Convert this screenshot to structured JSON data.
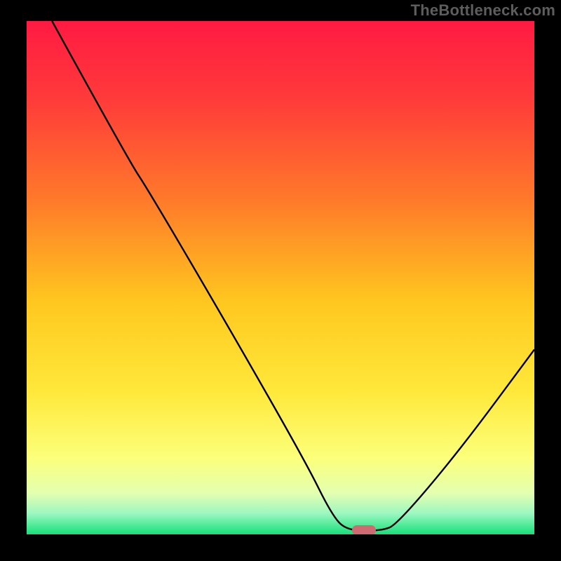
{
  "watermark": "TheBottleneck.com",
  "chart_data": {
    "type": "line",
    "title": "",
    "xlabel": "",
    "ylabel": "",
    "xlim": [
      0,
      100
    ],
    "ylim": [
      0,
      100
    ],
    "gradient_stops": [
      {
        "pos": 0,
        "color": "#ff1a43"
      },
      {
        "pos": 15,
        "color": "#ff3a3a"
      },
      {
        "pos": 35,
        "color": "#ff7a2a"
      },
      {
        "pos": 55,
        "color": "#ffc81f"
      },
      {
        "pos": 72,
        "color": "#ffe83a"
      },
      {
        "pos": 85,
        "color": "#fcff7a"
      },
      {
        "pos": 92,
        "color": "#e4ffb0"
      },
      {
        "pos": 96,
        "color": "#9af7c0"
      },
      {
        "pos": 100,
        "color": "#16e07a"
      }
    ],
    "series": [
      {
        "name": "curve",
        "points": [
          {
            "x": 5,
            "y": 100
          },
          {
            "x": 20,
            "y": 73
          },
          {
            "x": 24,
            "y": 67
          },
          {
            "x": 40,
            "y": 40
          },
          {
            "x": 55,
            "y": 14
          },
          {
            "x": 60,
            "y": 4
          },
          {
            "x": 63,
            "y": 0.7
          },
          {
            "x": 70,
            "y": 0.7
          },
          {
            "x": 73,
            "y": 2
          },
          {
            "x": 85,
            "y": 16
          },
          {
            "x": 100,
            "y": 36
          }
        ]
      }
    ],
    "marker": {
      "x": 66.5,
      "y": 0.8,
      "color": "#cf6a73"
    }
  }
}
